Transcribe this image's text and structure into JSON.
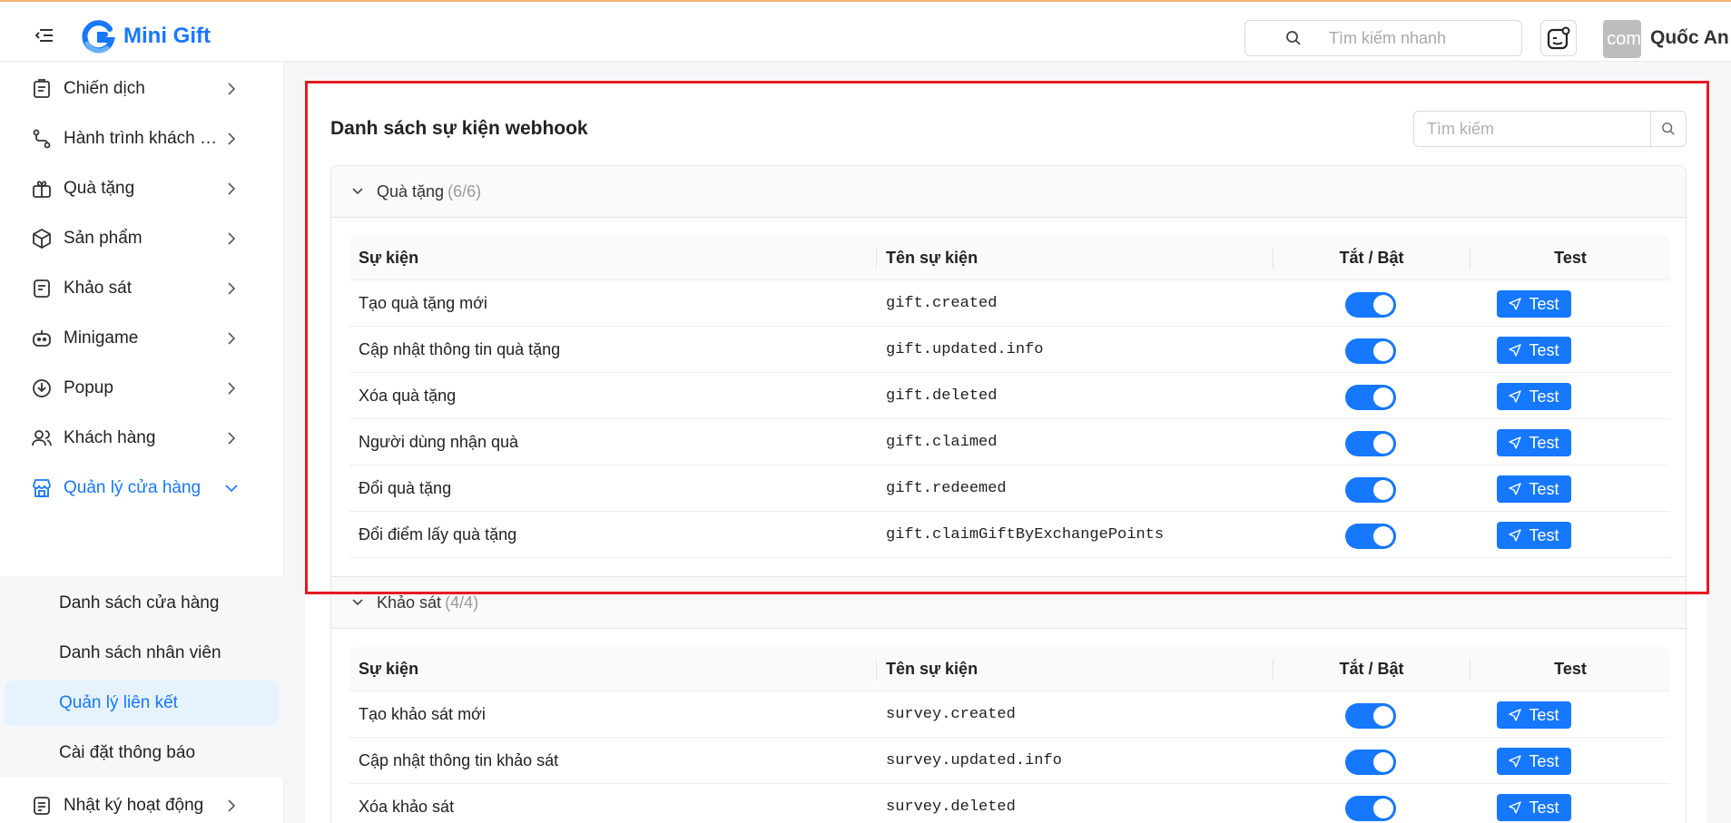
{
  "app": {
    "name": "Mini Gift",
    "brand_color": "#1677ff"
  },
  "header": {
    "quick_search_placeholder": "Tìm kiếm nhanh",
    "avatar_text": "com",
    "user_name": "Quốc An"
  },
  "sidebar": {
    "items": [
      {
        "label": "Chiến dịch",
        "icon": "clipboard-icon"
      },
      {
        "label": "Hành trình khách hàng",
        "icon": "route-icon"
      },
      {
        "label": "Quà tặng",
        "icon": "gift-icon"
      },
      {
        "label": "Sản phẩm",
        "icon": "box-icon"
      },
      {
        "label": "Khảo sát",
        "icon": "survey-icon"
      },
      {
        "label": "Minigame",
        "icon": "gamepad-icon"
      },
      {
        "label": "Popup",
        "icon": "popup-icon"
      },
      {
        "label": "Khách hàng",
        "icon": "users-icon"
      },
      {
        "label": "Quản lý cửa hàng",
        "icon": "store-icon",
        "expanded": true
      },
      {
        "label": "Nhật ký hoạt động",
        "icon": "log-icon"
      }
    ],
    "submenu": [
      {
        "label": "Danh sách cửa hàng"
      },
      {
        "label": "Danh sách nhân viên"
      },
      {
        "label": "Quản lý liên kết",
        "selected": true
      },
      {
        "label": "Cài đặt thông báo"
      }
    ]
  },
  "main": {
    "title": "Danh sách sự kiện webhook",
    "search_placeholder": "Tìm kiếm",
    "columns": {
      "event": "Sự kiện",
      "event_name": "Tên sự kiện",
      "toggle": "Tắt / Bật",
      "test": "Test"
    },
    "test_label": "Test",
    "groups": [
      {
        "title": "Quà tặng",
        "count": "(6/6)",
        "rows": [
          {
            "event": "Tạo quà tặng mới",
            "name": "gift.created",
            "enabled": true
          },
          {
            "event": "Cập nhật thông tin quà tặng",
            "name": "gift.updated.info",
            "enabled": true
          },
          {
            "event": "Xóa quà tặng",
            "name": "gift.deleted",
            "enabled": true
          },
          {
            "event": "Người dùng nhận quà",
            "name": "gift.claimed",
            "enabled": true
          },
          {
            "event": "Đổi quà tặng",
            "name": "gift.redeemed",
            "enabled": true
          },
          {
            "event": "Đổi điểm lấy quà tặng",
            "name": "gift.claimGiftByExchangePoints",
            "enabled": true
          }
        ]
      },
      {
        "title": "Khảo sát",
        "count": "(4/4)",
        "rows": [
          {
            "event": "Tạo khảo sát mới",
            "name": "survey.created",
            "enabled": true
          },
          {
            "event": "Cập nhật thông tin khảo sát",
            "name": "survey.updated.info",
            "enabled": true
          },
          {
            "event": "Xóa khảo sát",
            "name": "survey.deleted",
            "enabled": true
          }
        ]
      }
    ]
  },
  "colors": {
    "highlight": "#e31b23",
    "toggle_on": "#1677ff",
    "selected_bg": "#e6f3ff"
  }
}
